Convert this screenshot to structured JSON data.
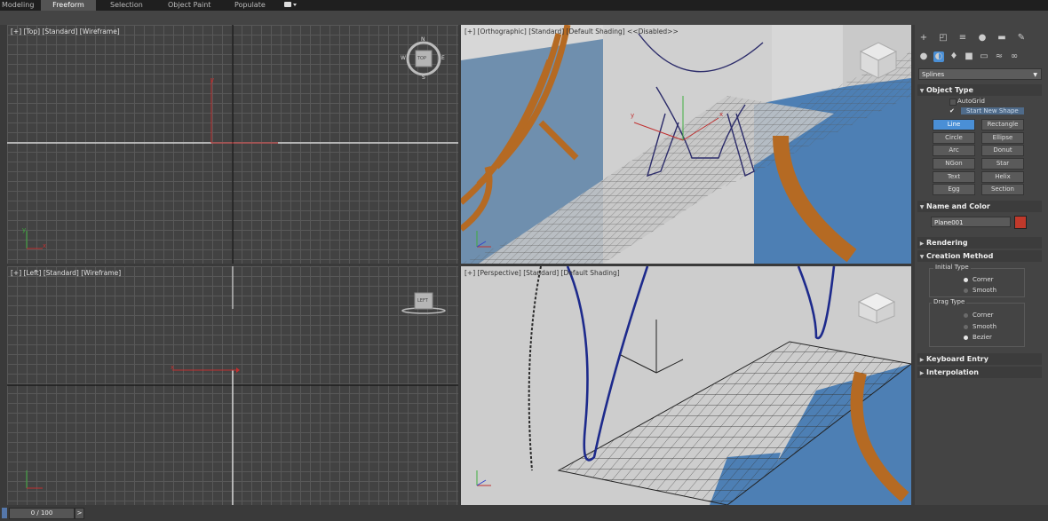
{
  "ribbon": {
    "tabs": [
      "Modeling",
      "Freeform",
      "Selection",
      "Object Paint",
      "Populate"
    ],
    "active_tab": "Freeform"
  },
  "viewports": {
    "top": {
      "label": "[+] [Top] [Standard] [Wireframe]",
      "cube_face": "TOP",
      "compass": {
        "n": "N",
        "s": "S",
        "e": "E",
        "w": "W"
      }
    },
    "left": {
      "label": "[+] [Left] [Standard] [Wireframe]",
      "cube_face": "LEFT"
    },
    "ortho": {
      "label": "[+] [Orthographic] [Standard] [Default Shading]  <<Disabled>>"
    },
    "perspective": {
      "label": "[+] [Perspective] [Standard] [Default Shading]"
    }
  },
  "axes": {
    "x": "x",
    "y": "y",
    "z": "z"
  },
  "command_panel": {
    "category": "Splines",
    "object_type": {
      "title": "Object Type",
      "autogrid": "AutoGrid",
      "autogrid_checked": false,
      "start_new_shape": "Start New Shape",
      "start_new_shape_checked": true,
      "buttons": [
        "Line",
        "Rectangle",
        "Circle",
        "Ellipse",
        "Arc",
        "Donut",
        "NGon",
        "Star",
        "Text",
        "Helix",
        "Egg",
        "Section"
      ],
      "selected": "Line"
    },
    "name_and_color": {
      "title": "Name and Color",
      "name": "Plane001",
      "color": "#c0392b"
    },
    "rendering": {
      "title": "Rendering"
    },
    "creation_method": {
      "title": "Creation Method",
      "initial_type": {
        "label": "Initial Type",
        "options": [
          "Corner",
          "Smooth"
        ],
        "selected": "Corner"
      },
      "drag_type": {
        "label": "Drag Type",
        "options": [
          "Corner",
          "Smooth",
          "Bezier"
        ],
        "selected": "Bezier"
      }
    },
    "keyboard_entry": {
      "title": "Keyboard Entry"
    },
    "interpolation": {
      "title": "Interpolation"
    }
  },
  "timeline": {
    "frame": "0 / 100",
    "next": ">"
  }
}
